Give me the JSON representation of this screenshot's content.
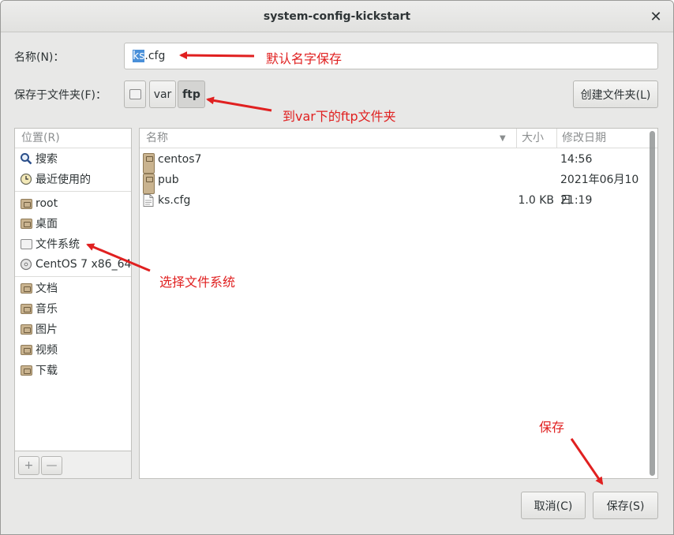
{
  "window": {
    "title": "system-config-kickstart"
  },
  "name_row": {
    "label": "名称(N)：",
    "value_selected": "ks",
    "value_rest": ".cfg"
  },
  "folder_row": {
    "label": "保存于文件夹(F)：",
    "path": [
      "var",
      "ftp"
    ],
    "create_folder_label": "创建文件夹(L)"
  },
  "places": {
    "header": "位置(R)",
    "items": [
      {
        "label": "搜索",
        "icon": "search-icon"
      },
      {
        "label": "最近使用的",
        "icon": "clock-icon"
      },
      {
        "label": "root",
        "icon": "home-folder-icon"
      },
      {
        "label": "桌面",
        "icon": "desktop-folder-icon"
      },
      {
        "label": "文件系统",
        "icon": "drive-icon"
      },
      {
        "label": "CentOS 7 x86_64",
        "icon": "disc-icon"
      },
      {
        "label": "文档",
        "icon": "documents-folder-icon"
      },
      {
        "label": "音乐",
        "icon": "music-folder-icon"
      },
      {
        "label": "图片",
        "icon": "pictures-folder-icon"
      },
      {
        "label": "视频",
        "icon": "videos-folder-icon"
      },
      {
        "label": "下载",
        "icon": "downloads-folder-icon"
      }
    ],
    "add_label": "+",
    "remove_label": "—"
  },
  "files": {
    "columns": {
      "name": "名称",
      "size": "大小",
      "modified": "修改日期"
    },
    "rows": [
      {
        "name": "centos7",
        "size": "",
        "modified": "14:56",
        "icon": "folder-icon"
      },
      {
        "name": "pub",
        "size": "",
        "modified": "2021年06月10日",
        "icon": "folder-icon"
      },
      {
        "name": "ks.cfg",
        "size": "1.0 KB",
        "modified": "21:19",
        "icon": "file-icon"
      }
    ]
  },
  "buttons": {
    "cancel": "取消(C)",
    "save": "保存(S)"
  },
  "annotations": {
    "name": "默认名字保存",
    "folder": "到var下的ftp文件夹",
    "filesystem": "选择文件系统",
    "save": "保存",
    "color": "#e02020"
  }
}
